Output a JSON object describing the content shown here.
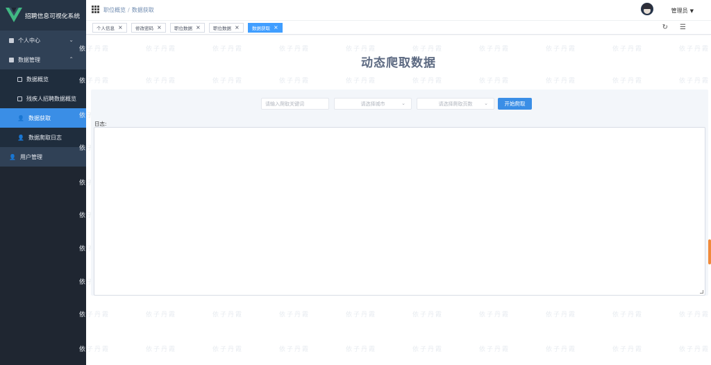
{
  "app": {
    "title": "招聘信息可视化系统",
    "logo_color": "#41b883"
  },
  "sidebar": {
    "items": [
      {
        "label": "个人中心",
        "icon": "square-icon",
        "type": "top"
      },
      {
        "label": "数据管理",
        "icon": "square-icon",
        "type": "top-open"
      },
      {
        "label": "数据概览",
        "icon": "doc-icon",
        "type": "sub"
      },
      {
        "label": "残疾人招聘数据概览",
        "icon": "doc-icon",
        "type": "sub"
      },
      {
        "label": "数据获取",
        "icon": "user-icon",
        "type": "sub-active"
      },
      {
        "label": "数据爬取日志",
        "icon": "user-icon",
        "type": "sub"
      },
      {
        "label": "用户管理",
        "icon": "user-icon",
        "type": "top"
      }
    ]
  },
  "header": {
    "breadcrumb": [
      "职位概览",
      "数据获取"
    ],
    "breadcrumb_sep": "/",
    "user_label": "管理员"
  },
  "tags": [
    {
      "label": "个人信息",
      "active": false
    },
    {
      "label": "修改密码",
      "active": false
    },
    {
      "label": "职位数据",
      "active": false
    },
    {
      "label": "职位数据",
      "active": false
    },
    {
      "label": "数据获取",
      "active": true
    }
  ],
  "page": {
    "title": "动态爬取数据",
    "keyword_placeholder": "请输入爬取关键词",
    "city_placeholder": "请选择城市",
    "pages_placeholder": "请选择爬取页数",
    "crawl_button": "开始爬取",
    "log_label": "日志:",
    "log_content": ""
  },
  "watermark_text": "依子丹霞",
  "colors": {
    "sidebar_bg": "#1f2631",
    "accent": "#409eff",
    "active_menu": "#3a8ee6"
  }
}
